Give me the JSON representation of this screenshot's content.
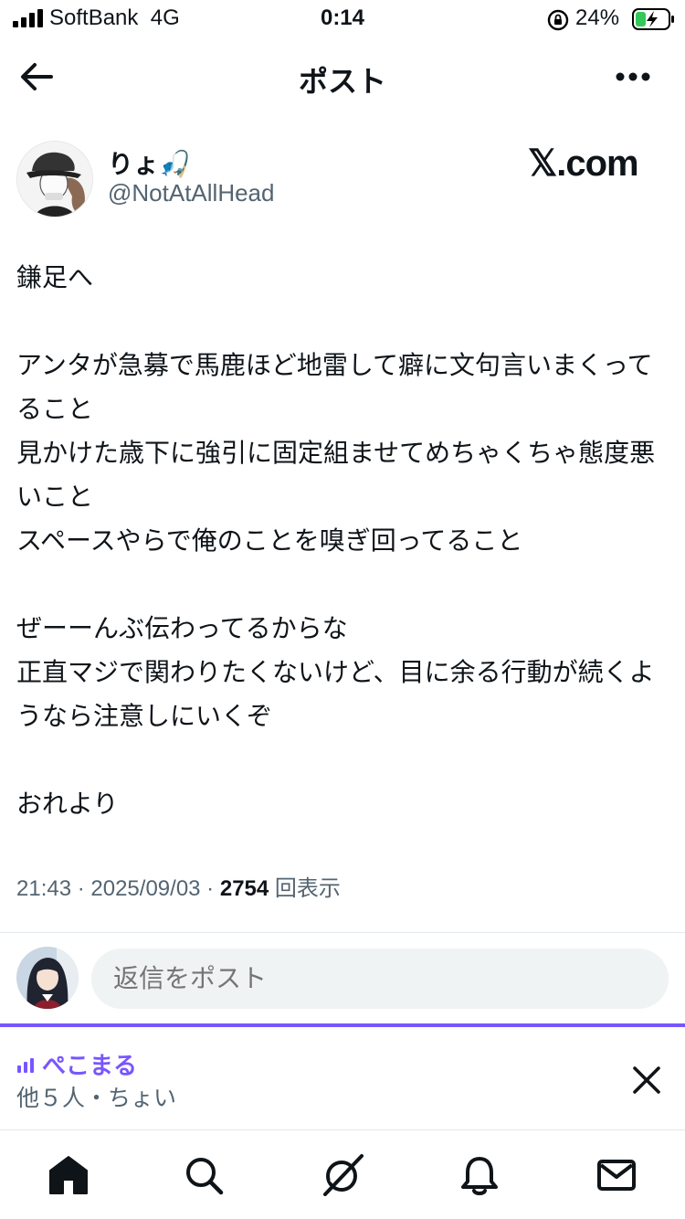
{
  "status_bar": {
    "carrier": "SoftBank",
    "network": "4G",
    "time": "0:14",
    "battery_percent": "24%"
  },
  "header": {
    "title": "ポスト",
    "back_icon": "arrow-left-icon",
    "more_icon": "more-horizontal-icon"
  },
  "post": {
    "author_name": "りょ🎣",
    "author_handle": "@NotAtAllHead",
    "source_badge": "𝕏.com",
    "text": "鎌足へ\n\nアンタが急募で馬鹿ほど地雷して癖に文句言いまくってること\n見かけた歳下に強引に固定組ませてめちゃくちゃ態度悪いこと\nスペースやらで俺のことを嗅ぎ回ってること\n\nぜーーんぶ伝わってるからな\n正直マジで関わりたくないけど、目に余る行動が続くようなら注意しにいくぞ\n\nおれより",
    "time": "21:43",
    "date": "2025/09/03",
    "views_count": "2754",
    "views_label": "回表示"
  },
  "reply": {
    "placeholder": "返信をポスト"
  },
  "space": {
    "title": "ぺこまる",
    "subtitle": "他５人・ちょい",
    "accent_color": "#7856ff"
  },
  "tab_bar": {
    "items": [
      "home-icon",
      "search-icon",
      "grok-icon",
      "notifications-icon",
      "messages-icon"
    ]
  }
}
